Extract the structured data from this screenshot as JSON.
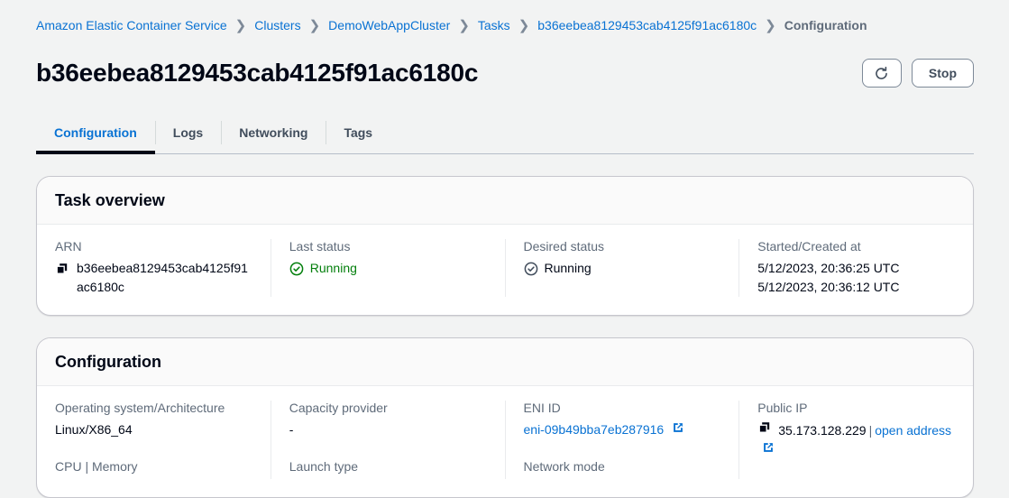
{
  "breadcrumb": {
    "items": [
      {
        "label": "Amazon Elastic Container Service",
        "current": false
      },
      {
        "label": "Clusters",
        "current": false
      },
      {
        "label": "DemoWebAppCluster",
        "current": false
      },
      {
        "label": "Tasks",
        "current": false
      },
      {
        "label": "b36eebea8129453cab4125f91ac6180c",
        "current": false
      },
      {
        "label": "Configuration",
        "current": true
      }
    ],
    "separator": "❯"
  },
  "header": {
    "title": "b36eebea8129453cab4125f91ac6180c",
    "refresh_label": "⟳",
    "stop_label": "Stop"
  },
  "tabs": [
    {
      "label": "Configuration",
      "active": true
    },
    {
      "label": "Logs",
      "active": false
    },
    {
      "label": "Networking",
      "active": false
    },
    {
      "label": "Tags",
      "active": false
    }
  ],
  "task_overview": {
    "title": "Task overview",
    "arn": {
      "label": "ARN",
      "value": "b36eebea8129453cab4125f91ac6180c",
      "copy_icon": "copy-icon"
    },
    "last_status": {
      "label": "Last status",
      "value": "Running",
      "icon": "check-circle-icon",
      "color": "#037f0c"
    },
    "desired_status": {
      "label": "Desired status",
      "value": "Running",
      "icon": "check-circle-icon",
      "color": "#414d5c"
    },
    "started_created": {
      "label": "Started/Created at",
      "started": "5/12/2023, 20:36:25 UTC",
      "created": "5/12/2023, 20:36:12 UTC"
    }
  },
  "configuration": {
    "title": "Configuration",
    "os_architecture": {
      "label": "Operating system/Architecture",
      "value": "Linux/X86_64"
    },
    "cpu_memory": {
      "label": "CPU | Memory"
    },
    "capacity_provider": {
      "label": "Capacity provider",
      "value": "-"
    },
    "launch_type": {
      "label": "Launch type"
    },
    "eni_id": {
      "label": "ENI ID",
      "value": "eni-09b49bba7eb287916",
      "external_icon": "external-link-icon"
    },
    "network_mode": {
      "label": "Network mode"
    },
    "public_ip": {
      "label": "Public IP",
      "value": "35.173.128.229",
      "separator": "|",
      "link_label": "open address",
      "copy_icon": "copy-icon",
      "external_icon": "external-link-icon"
    }
  }
}
